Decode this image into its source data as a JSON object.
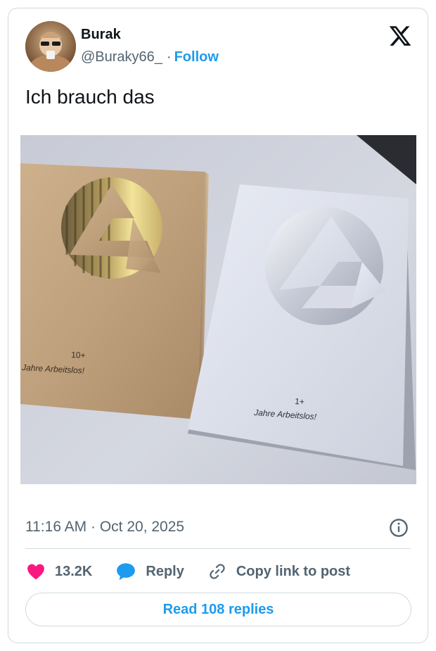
{
  "author": {
    "display_name": "Burak",
    "handle": "@Buraky66_",
    "separator": "·",
    "follow_label": "Follow"
  },
  "tweet": {
    "text": "Ich brauch das",
    "timestamp": "11:16 AM · Oct 20, 2025"
  },
  "media": {
    "left_plaque": {
      "count": "10+",
      "caption": "Jahre Arbeitslos!"
    },
    "right_plaque": {
      "count": "1+",
      "caption": "Jahre Arbeitslos!"
    }
  },
  "actions": {
    "like_count": "13.2K",
    "reply_label": "Reply",
    "copy_label": "Copy link to post"
  },
  "read_replies_label": "Read 108 replies",
  "icons": {
    "brand": "x-logo-icon",
    "like": "heart-icon",
    "reply": "speech-bubble-icon",
    "copy": "link-icon",
    "info": "info-icon"
  },
  "colors": {
    "accent": "#1d9bf0",
    "like": "#f91880",
    "text": "#0f1419",
    "muted": "#536471",
    "border": "#cfd9de"
  }
}
